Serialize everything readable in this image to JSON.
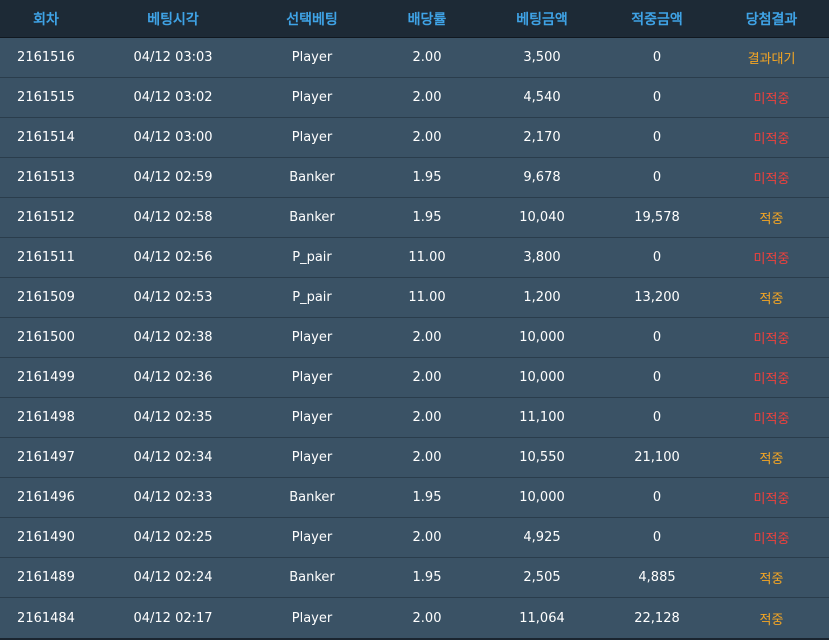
{
  "colors": {
    "header_text": "#3fa3e6",
    "row_bg": "#3a5265",
    "win": "#f5a623",
    "lose": "#f0403c",
    "wait": "#f5a623"
  },
  "headers": [
    "회차",
    "베팅시각",
    "선택베팅",
    "배당률",
    "베팅금액",
    "적중금액",
    "당첨결과"
  ],
  "rows": [
    {
      "round": "2161516",
      "time": "04/12 03:03",
      "pick": "Player",
      "odds": "2.00",
      "bet": "3,500",
      "win_amount": "0",
      "result": "결과대기",
      "status": "wait"
    },
    {
      "round": "2161515",
      "time": "04/12 03:02",
      "pick": "Player",
      "odds": "2.00",
      "bet": "4,540",
      "win_amount": "0",
      "result": "미적중",
      "status": "lose"
    },
    {
      "round": "2161514",
      "time": "04/12 03:00",
      "pick": "Player",
      "odds": "2.00",
      "bet": "2,170",
      "win_amount": "0",
      "result": "미적중",
      "status": "lose"
    },
    {
      "round": "2161513",
      "time": "04/12 02:59",
      "pick": "Banker",
      "odds": "1.95",
      "bet": "9,678",
      "win_amount": "0",
      "result": "미적중",
      "status": "lose"
    },
    {
      "round": "2161512",
      "time": "04/12 02:58",
      "pick": "Banker",
      "odds": "1.95",
      "bet": "10,040",
      "win_amount": "19,578",
      "result": "적중",
      "status": "win"
    },
    {
      "round": "2161511",
      "time": "04/12 02:56",
      "pick": "P_pair",
      "odds": "11.00",
      "bet": "3,800",
      "win_amount": "0",
      "result": "미적중",
      "status": "lose"
    },
    {
      "round": "2161509",
      "time": "04/12 02:53",
      "pick": "P_pair",
      "odds": "11.00",
      "bet": "1,200",
      "win_amount": "13,200",
      "result": "적중",
      "status": "win"
    },
    {
      "round": "2161500",
      "time": "04/12 02:38",
      "pick": "Player",
      "odds": "2.00",
      "bet": "10,000",
      "win_amount": "0",
      "result": "미적중",
      "status": "lose"
    },
    {
      "round": "2161499",
      "time": "04/12 02:36",
      "pick": "Player",
      "odds": "2.00",
      "bet": "10,000",
      "win_amount": "0",
      "result": "미적중",
      "status": "lose"
    },
    {
      "round": "2161498",
      "time": "04/12 02:35",
      "pick": "Player",
      "odds": "2.00",
      "bet": "11,100",
      "win_amount": "0",
      "result": "미적중",
      "status": "lose"
    },
    {
      "round": "2161497",
      "time": "04/12 02:34",
      "pick": "Player",
      "odds": "2.00",
      "bet": "10,550",
      "win_amount": "21,100",
      "result": "적중",
      "status": "win"
    },
    {
      "round": "2161496",
      "time": "04/12 02:33",
      "pick": "Banker",
      "odds": "1.95",
      "bet": "10,000",
      "win_amount": "0",
      "result": "미적중",
      "status": "lose"
    },
    {
      "round": "2161490",
      "time": "04/12 02:25",
      "pick": "Player",
      "odds": "2.00",
      "bet": "4,925",
      "win_amount": "0",
      "result": "미적중",
      "status": "lose"
    },
    {
      "round": "2161489",
      "time": "04/12 02:24",
      "pick": "Banker",
      "odds": "1.95",
      "bet": "2,505",
      "win_amount": "4,885",
      "result": "적중",
      "status": "win"
    },
    {
      "round": "2161484",
      "time": "04/12 02:17",
      "pick": "Player",
      "odds": "2.00",
      "bet": "11,064",
      "win_amount": "22,128",
      "result": "적중",
      "status": "win"
    }
  ]
}
